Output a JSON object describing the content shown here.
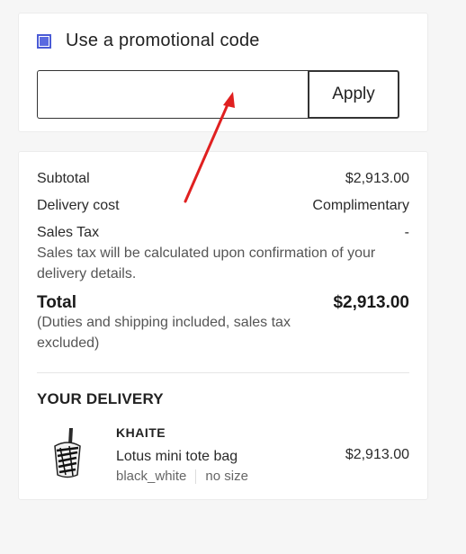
{
  "promo": {
    "checkbox_label": "Use a promotional code",
    "checked": true,
    "input_value": "",
    "input_placeholder": "",
    "apply_label": "Apply"
  },
  "summary": {
    "subtotal_label": "Subtotal",
    "subtotal_value": "$2,913.00",
    "delivery_label": "Delivery cost",
    "delivery_value": "Complimentary",
    "tax_label": "Sales Tax",
    "tax_value": "-",
    "tax_note": "Sales tax will be calculated upon confirmation of your delivery details.",
    "total_label": "Total",
    "total_value": "$2,913.00",
    "total_note": "(Duties and shipping included, sales tax excluded)"
  },
  "delivery": {
    "title": "YOUR DELIVERY",
    "item": {
      "brand": "KHAITE",
      "name": "Lotus mini tote bag",
      "price": "$2,913.00",
      "color": "black_white",
      "size": "no size"
    }
  },
  "colors": {
    "checkbox_accent": "#5a6ae0",
    "annotation_arrow": "#e02020"
  }
}
